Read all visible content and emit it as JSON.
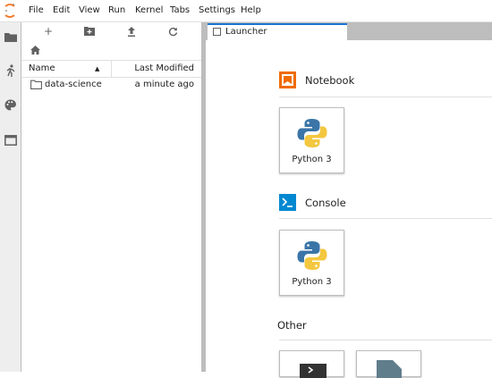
{
  "menu": [
    "File",
    "Edit",
    "View",
    "Run",
    "Kernel",
    "Tabs",
    "Settings",
    "Help"
  ],
  "filebrowser": {
    "columns": {
      "name": "Name",
      "modified": "Last Modified"
    },
    "rows": [
      {
        "name": "data-science",
        "modified": "a minute ago"
      }
    ]
  },
  "tab": {
    "label": "Launcher"
  },
  "launcher": {
    "notebook": {
      "title": "Notebook",
      "card_label": "Python 3"
    },
    "console": {
      "title": "Console",
      "card_label": "Python 3"
    },
    "other": {
      "title": "Other"
    }
  },
  "colors": {
    "accent": "#1976d2",
    "notebook_icon": "#ef6c00",
    "console_icon": "#0288d1",
    "python_blue": "#3b75a8",
    "python_yellow": "#f3c73f"
  }
}
